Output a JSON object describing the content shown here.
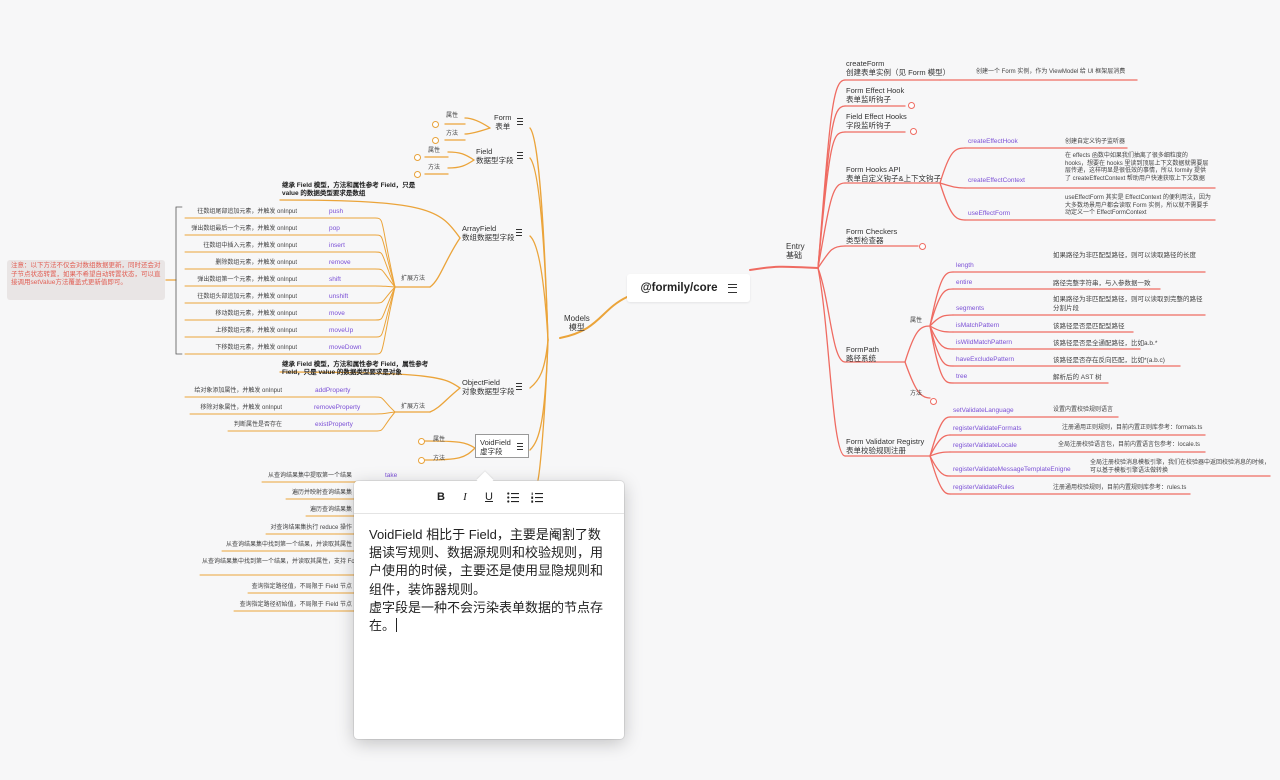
{
  "root": {
    "label": "@formily/core"
  },
  "models": {
    "label": "Models",
    "sub": "模型"
  },
  "entry": {
    "label": "Entry",
    "sub": "基础"
  },
  "left": {
    "form": {
      "label": "Form",
      "sub": "表单",
      "attr": "属性",
      "method": "方法"
    },
    "field": {
      "label": "Field",
      "sub": "数据型字段",
      "attr": "属性",
      "method": "方法"
    },
    "arrayfield": {
      "label": "ArrayField",
      "sub": "数组数据型字段",
      "inherit": "继承 Field 模型，方法和属性参考 Field，只是 value 的数据类型要求是数组",
      "ext": "扩展方法",
      "methods": [
        {
          "key": "push",
          "desc": "往数组尾部追加元素，并触发 onInput"
        },
        {
          "key": "pop",
          "desc": "弹出数组最后一个元素，并触发 onInput"
        },
        {
          "key": "insert",
          "desc": "往数组中插入元素，并触发 onInput"
        },
        {
          "key": "remove",
          "desc": "删除数组元素，并触发 onInput"
        },
        {
          "key": "shift",
          "desc": "弹出数组第一个元素，并触发 onInput"
        },
        {
          "key": "unshift",
          "desc": "往数组头部追加元素，并触发 onInput"
        },
        {
          "key": "move",
          "desc": "移动数组元素，并触发 onInput"
        },
        {
          "key": "moveUp",
          "desc": "上移数组元素，并触发 onInput"
        },
        {
          "key": "moveDown",
          "desc": "下移数组元素，并触发 onInput"
        }
      ]
    },
    "note": "注意：以下方法不仅会对数组数据更新，同时还会对子节点状态转置，如果不希望自动转置状态，可以直接调用setValue方法覆盖式更新值即可。",
    "objectfield": {
      "label": "ObjectField",
      "sub": "对象数据型字段",
      "inherit": "继承 Field 模型，方法和属性参考 Field，属性参考 Field，只是 value 的数据类型要求是对象",
      "ext": "扩展方法",
      "methods": [
        {
          "key": "addProperty",
          "desc": "给对象添加属性，并触发 onInput"
        },
        {
          "key": "removeProperty",
          "desc": "移除对象属性，并触发 onInput"
        },
        {
          "key": "existProperty",
          "desc": "判断属性是否存在"
        }
      ]
    },
    "voidfield": {
      "label": "VoidField",
      "sub": "虚字段",
      "attr": "属性",
      "method": "方法"
    },
    "query": {
      "take": "take",
      "items": [
        "从查询结果集中提取第一个结果",
        "遍历并映射查询结果集",
        "遍历查询结果集",
        "对查询结果集执行 reduce 操作",
        "从查询结果集中找到第一个结果，并读取其属性",
        "从查询结果集中找到第一个结果，并读取其属性，支持 FormPathPattern 路径语法",
        "查询指定路径值，不局限于 Field 节点",
        "查询指定路径初始值，不局限于 Field 节点"
      ]
    }
  },
  "right": {
    "createForm": {
      "label": "createForm",
      "sub": "创建表单实例（见 Form 模型）",
      "desc": "创建一个 Form 实例，作为 ViewModel 给 UI 框架层消费"
    },
    "formEffect": {
      "label": "Form Effect Hook",
      "sub": "表单监听钩子"
    },
    "fieldEffect": {
      "label": "Field Effect Hooks",
      "sub": "字段监听钩子"
    },
    "formHooks": {
      "label": "Form Hooks API",
      "sub": "表单自定义钩子&上下文钩子",
      "items": [
        {
          "key": "createEffectHook",
          "desc": "创建自定义钩子监听器"
        },
        {
          "key": "createEffectContext",
          "desc": "在 effects 函数中如果我们抽离了很多细粒度的 hooks，想要在 hooks 里读到顶层上下文数据就需要层层传递，这样明显是很低效的事情，所以 formily 提供了 createEffectContext 帮助用户快速获取上下文数据"
        },
        {
          "key": "useEffectForm",
          "desc": "useEffectForm 其实是 EffectContext 的便利用法，因为大多数场景用户都会读取 Form 实例，所以就不需要手动定义一个 EffectFormContext"
        }
      ]
    },
    "checkers": {
      "label": "Form Checkers",
      "sub": "类型检查器"
    },
    "formPath": {
      "label": "FormPath",
      "sub": "路径系统",
      "attr": "属性",
      "method": "方法",
      "items": [
        {
          "key": "length",
          "desc": "如果路径为非匹配型路径，则可以读取路径的长度"
        },
        {
          "key": "entire",
          "desc": "路径完整字符串，与入参数据一致"
        },
        {
          "key": "segments",
          "desc": "如果路径为非匹配型路径，则可以读取到完整的路径分割片段"
        },
        {
          "key": "isMatchPattern",
          "desc": "该路径是否是匹配型路径"
        },
        {
          "key": "isWildMatchPattern",
          "desc": "该路径是否是全通配路径，比如a.b.*"
        },
        {
          "key": "haveExcludePattern",
          "desc": "该路径是否存在反向匹配，比如*(a.b.c)"
        },
        {
          "key": "tree",
          "desc": "解析后的 AST 树"
        }
      ]
    },
    "validator": {
      "label": "Form Validator Registry",
      "sub": "表单校验规则注册",
      "items": [
        {
          "key": "setValidateLanguage",
          "desc": "设置内置校验规则语言"
        },
        {
          "key": "registerValidateFormats",
          "desc": "注册通用正则规则，目前内置正则库参考：formats.ts"
        },
        {
          "key": "registerValidateLocale",
          "desc": "全局注册校验语言包，目前内置语言包参考：locale.ts"
        },
        {
          "key": "registerValidateMessageTemplateEnigne",
          "desc": "全局注册校验消息模板引擎，我们在校验器中返回校验消息的时候，可以基于模板引擎语法做转换"
        },
        {
          "key": "registerValidateRules",
          "desc": "注册通用校验规则，目前内置规则库参考：rules.ts"
        }
      ]
    }
  },
  "popup": {
    "toolbar": {
      "bold": "B",
      "italic": "I",
      "underline": "U"
    },
    "text": "VoidField 相比于 Field，主要是阉割了数据读写规则、数据源规则和校验规则，用户使用的时候，主要还是使用显隐规则和组件，装饰器规则。\n虚字段是一种不会污染表单数据的节点存在。"
  },
  "colors": {
    "left_branch": "#eba43a",
    "right_branch": "#ef6b62",
    "key_text": "#7b4fd6",
    "note_text": "#e15f55"
  }
}
